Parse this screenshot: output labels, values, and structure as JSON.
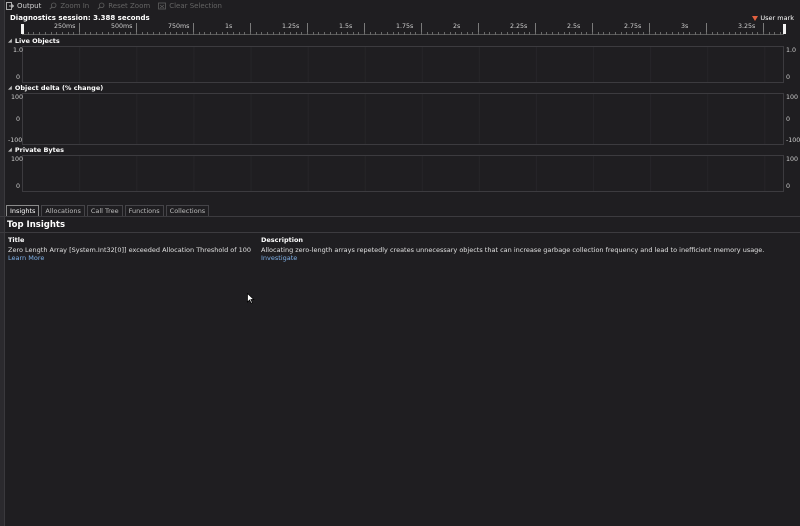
{
  "toolbar": {
    "output": "Output",
    "zoom_in": "Zoom In",
    "reset_zoom": "Reset Zoom",
    "clear_selection": "Clear Selection"
  },
  "session_label": "Diagnostics session: 3.388 seconds",
  "user_mark": "User mark",
  "ruler_ticks": [
    "250ms",
    "500ms",
    "750ms",
    "1s",
    "1.25s",
    "1.5s",
    "1.75s",
    "2s",
    "2.25s",
    "2.5s",
    "2.75s",
    "3s",
    "3.25s"
  ],
  "graphs": {
    "live_objects": {
      "title": "Live Objects",
      "y_top": "1.0",
      "y_bottom": "0"
    },
    "object_delta": {
      "title": "Object delta (% change)",
      "y_top": "100",
      "y_mid": "0",
      "y_bottom": "-100"
    },
    "private_bytes": {
      "title": "Private Bytes",
      "y_top": "100",
      "y_bottom": "0"
    }
  },
  "tabs": [
    "Insights",
    "Allocations",
    "Call Tree",
    "Functions",
    "Collections"
  ],
  "active_tab": "Insights",
  "insights": {
    "heading": "Top Insights",
    "col_title": "Title",
    "col_description": "Description",
    "rows": [
      {
        "title": "Zero Length Array [System.Int32[0]] exceeded Allocation Threshold of 100",
        "title_link": "Learn More",
        "description": "Allocating zero-length arrays repetedly creates unnecessary objects that can increase garbage collection frequency and lead to inefficient memory usage.",
        "description_link": "Investigate"
      }
    ]
  },
  "colors": {
    "background": "#1f1e21",
    "link": "#7fb1e8",
    "user_mark": "#e2603f"
  },
  "icons": {
    "output": "output-icon",
    "zoom_in": "zoom-in-icon",
    "reset_zoom": "reset-zoom-icon",
    "clear_selection": "clear-selection-icon",
    "user_mark": "user-mark-icon"
  }
}
